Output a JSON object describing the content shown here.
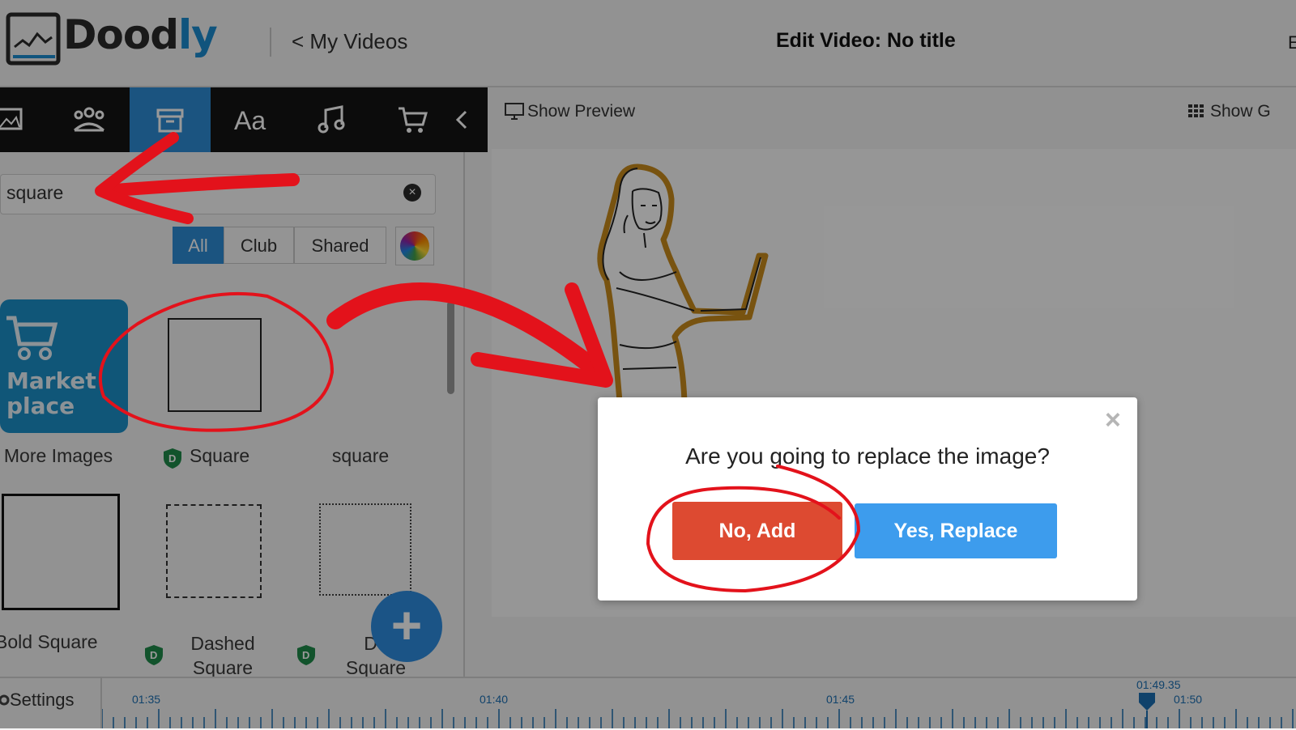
{
  "header": {
    "logo_text": "Doodly",
    "back_link": "< My Videos",
    "title": "Edit Video: No title",
    "right_text": "E"
  },
  "toolbar": {
    "icons": [
      "image-icon",
      "characters-icon",
      "props-icon",
      "text-icon",
      "music-icon",
      "cart-icon",
      "chevron-left-icon"
    ],
    "active_index": 2
  },
  "search": {
    "value": "square"
  },
  "filters": [
    "All",
    "Club",
    "Shared"
  ],
  "assets": {
    "marketplace_label": "Market place",
    "row1": [
      "More Images",
      "Square",
      "square"
    ],
    "row2": [
      "Bold Square",
      "Dashed Square",
      "Do Square"
    ]
  },
  "preview_bar": {
    "show_preview": "Show Preview",
    "show_grid": "Show G"
  },
  "timeline": {
    "settings": "Settings",
    "ticks": [
      "01:35",
      "01:40",
      "01:45",
      "01:50"
    ],
    "playhead": "01:49.35"
  },
  "dialog": {
    "message": "Are you going to replace the image?",
    "no_label": "No, Add",
    "yes_label": "Yes, Replace",
    "close": "×"
  },
  "colors": {
    "accent_blue": "#2d8cd6",
    "no_button": "#dd4a31",
    "yes_button": "#3d9ced",
    "annotation_red": "#e3121b"
  }
}
